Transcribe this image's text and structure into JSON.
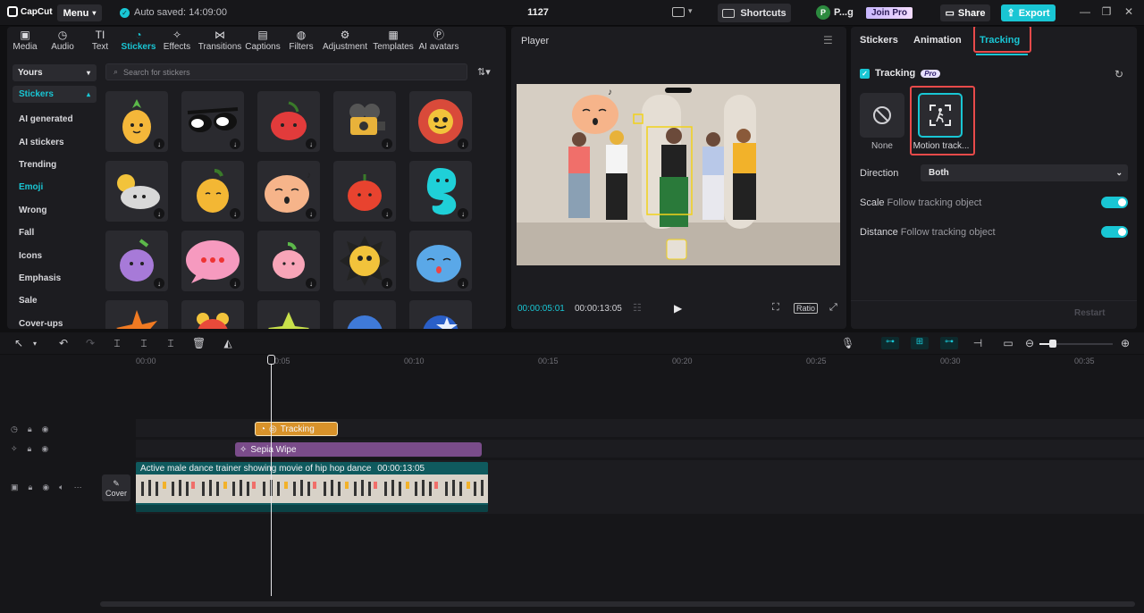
{
  "app": {
    "logo": "CapCut",
    "menu_label": "Menu",
    "autosave": "Auto saved: 14:09:00",
    "project_title": "1127",
    "shortcuts_label": "Shortcuts",
    "user_initial": "P",
    "user_name": "P...g",
    "join_pro": "Join Pro",
    "share_label": "Share",
    "export_label": "Export"
  },
  "toolbar_tabs": [
    {
      "label": "Media",
      "icon": "media-icon"
    },
    {
      "label": "Audio",
      "icon": "audio-icon"
    },
    {
      "label": "Text",
      "icon": "text-icon"
    },
    {
      "label": "Stickers",
      "icon": "stickers-icon"
    },
    {
      "label": "Effects",
      "icon": "effects-icon"
    },
    {
      "label": "Transitions",
      "icon": "transitions-icon"
    },
    {
      "label": "Captions",
      "icon": "captions-icon"
    },
    {
      "label": "Filters",
      "icon": "filters-icon"
    },
    {
      "label": "Adjustment",
      "icon": "adjustment-icon"
    },
    {
      "label": "Templates",
      "icon": "templates-icon"
    },
    {
      "label": "AI avatars",
      "icon": "ai-avatars-icon"
    }
  ],
  "stickers_panel": {
    "source_select": "Yours",
    "section_head": "Stickers",
    "categories": [
      "AI generated",
      "AI stickers",
      "Trending",
      "Emoji",
      "Wrong",
      "Fall",
      "Icons",
      "Emphasis",
      "Sale",
      "Cover-ups"
    ],
    "active_category": "Emoji",
    "search_placeholder": "Search for stickers"
  },
  "player": {
    "title": "Player",
    "current_time": "00:00:05:01",
    "total_time": "00:00:13:05",
    "ratio_label": "Ratio"
  },
  "right_panel": {
    "tabs": [
      "Stickers",
      "Animation",
      "Tracking"
    ],
    "active_tab": "Tracking",
    "tracking_label": "Tracking",
    "pro_badge": "Pro",
    "options": [
      {
        "label": "None",
        "icon": "none-icon"
      },
      {
        "label": "Motion track...",
        "icon": "motion-tracking-icon"
      }
    ],
    "direction_label": "Direction",
    "direction_value": "Both",
    "scale_label": "Scale",
    "scale_sub": "Follow tracking object",
    "distance_label": "Distance",
    "distance_sub": "Follow tracking object",
    "restart_label": "Restart"
  },
  "timeline": {
    "ticks": [
      "00:00",
      "00:05",
      "00:10",
      "00:15",
      "00:20",
      "00:25",
      "00:30",
      "00:35"
    ],
    "tracking_clip": "Tracking",
    "effect_clip": "Sepia Wipe",
    "video_clip_title": "Active male dance trainer showing movie of hip hop dance",
    "video_clip_duration": "00:00:13:05",
    "cover_label": "Cover"
  },
  "colors": {
    "accent": "#19c6d4",
    "highlight": "#e84a4a",
    "tracking_clip": "#d8922a",
    "effect_clip": "#7a4c8a",
    "video_clip": "#0f5a5e"
  }
}
